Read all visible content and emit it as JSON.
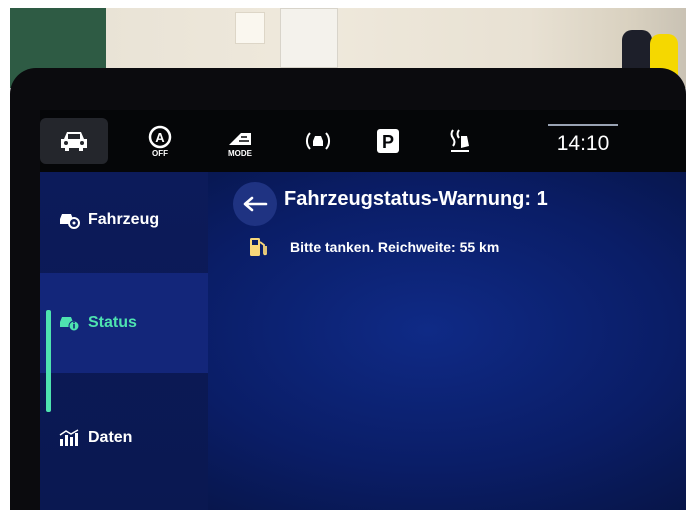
{
  "topbar": {
    "items": [
      {
        "name": "car",
        "icon": "car-icon",
        "active": true
      },
      {
        "name": "auto-hold",
        "icon": "auto-hold-off-icon",
        "label": "OFF"
      },
      {
        "name": "drive-mode",
        "icon": "drive-mode-icon",
        "label": "MODE"
      },
      {
        "name": "assist",
        "icon": "assist-icon"
      },
      {
        "name": "parking",
        "icon": "parking-icon",
        "label": "P"
      },
      {
        "name": "seat-heating",
        "icon": "seat-heating-icon"
      }
    ],
    "time": "14:10"
  },
  "sidebar": {
    "items": [
      {
        "label": "Fahrzeug",
        "icon": "vehicle-settings-icon"
      },
      {
        "label": "Status",
        "icon": "vehicle-status-icon",
        "selected": true
      },
      {
        "label": "Daten",
        "icon": "data-chart-icon"
      }
    ]
  },
  "main": {
    "title": "Fahrzeugstatus-Warnung: 1",
    "messages": [
      {
        "icon": "fuel-pump-icon",
        "text": "Bitte tanken. Reichweite: 55 km"
      }
    ]
  },
  "colors": {
    "accent": "#4ee3b0",
    "background": "#0a1d66",
    "topbar": "#050608"
  }
}
